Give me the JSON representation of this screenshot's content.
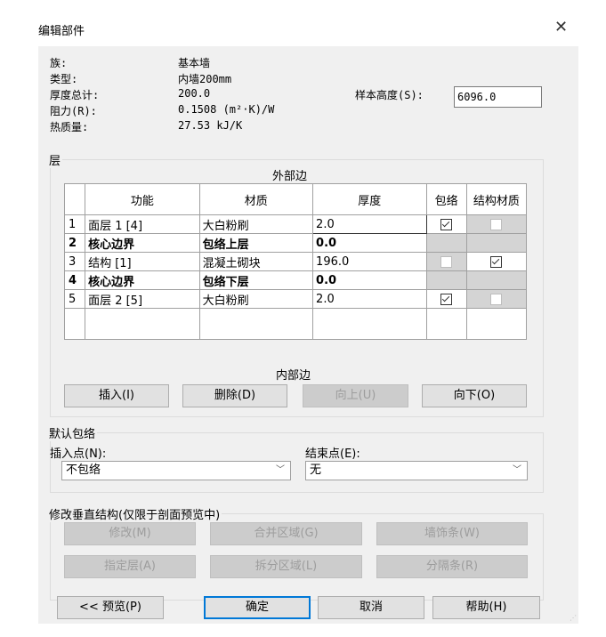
{
  "window": {
    "title": "编辑部件"
  },
  "properties": {
    "family_label": "族:",
    "family_value": "基本墙",
    "type_label": "类型:",
    "type_value": "内墙200mm",
    "thickness_label": "厚度总计:",
    "thickness_value": "200.0",
    "resistance_label": "阻力(R):",
    "resistance_value": "0.1508 (m²·K)/W",
    "thermal_label": "热质量:",
    "thermal_value": "27.53 kJ/K",
    "sample_height_label": "样本高度(S):",
    "sample_height_value": "6096.0"
  },
  "layers": {
    "group_label": "层",
    "exterior_label": "外部边",
    "interior_label": "内部边",
    "columns": [
      "功能",
      "材质",
      "厚度",
      "包络",
      "结构材质"
    ],
    "rows": [
      {
        "num": "1",
        "function": "面层 1 [4]",
        "material": "大白粉刷",
        "thickness": "2.0"
      },
      {
        "num": "2",
        "function": "核心边界",
        "material": "包络上层",
        "thickness": "0.0"
      },
      {
        "num": "3",
        "function": "结构 [1]",
        "material": "混凝土砌块",
        "thickness": "196.0"
      },
      {
        "num": "4",
        "function": "核心边界",
        "material": "包络下层",
        "thickness": "0.0"
      },
      {
        "num": "5",
        "function": "面层 2 [5]",
        "material": "大白粉刷",
        "thickness": "2.0"
      }
    ],
    "buttons": {
      "insert": "插入(I)",
      "delete": "删除(D)",
      "up": "向上(U)",
      "down": "向下(O)"
    }
  },
  "wrapping": {
    "group_label": "默认包络",
    "insert_label": "插入点(N):",
    "insert_value": "不包络",
    "end_label": "结束点(E):",
    "end_value": "无"
  },
  "vertical": {
    "group_label": "修改垂直结构(仅限于剖面预览中)",
    "buttons": {
      "modify": "修改(M)",
      "merge": "合并区域(G)",
      "sweeps": "墙饰条(W)",
      "assign": "指定层(A)",
      "split": "拆分区域(L)",
      "reveals": "分隔条(R)"
    }
  },
  "footer": {
    "preview": "<< 预览(P)",
    "ok": "确定",
    "cancel": "取消",
    "help": "帮助(H)"
  }
}
